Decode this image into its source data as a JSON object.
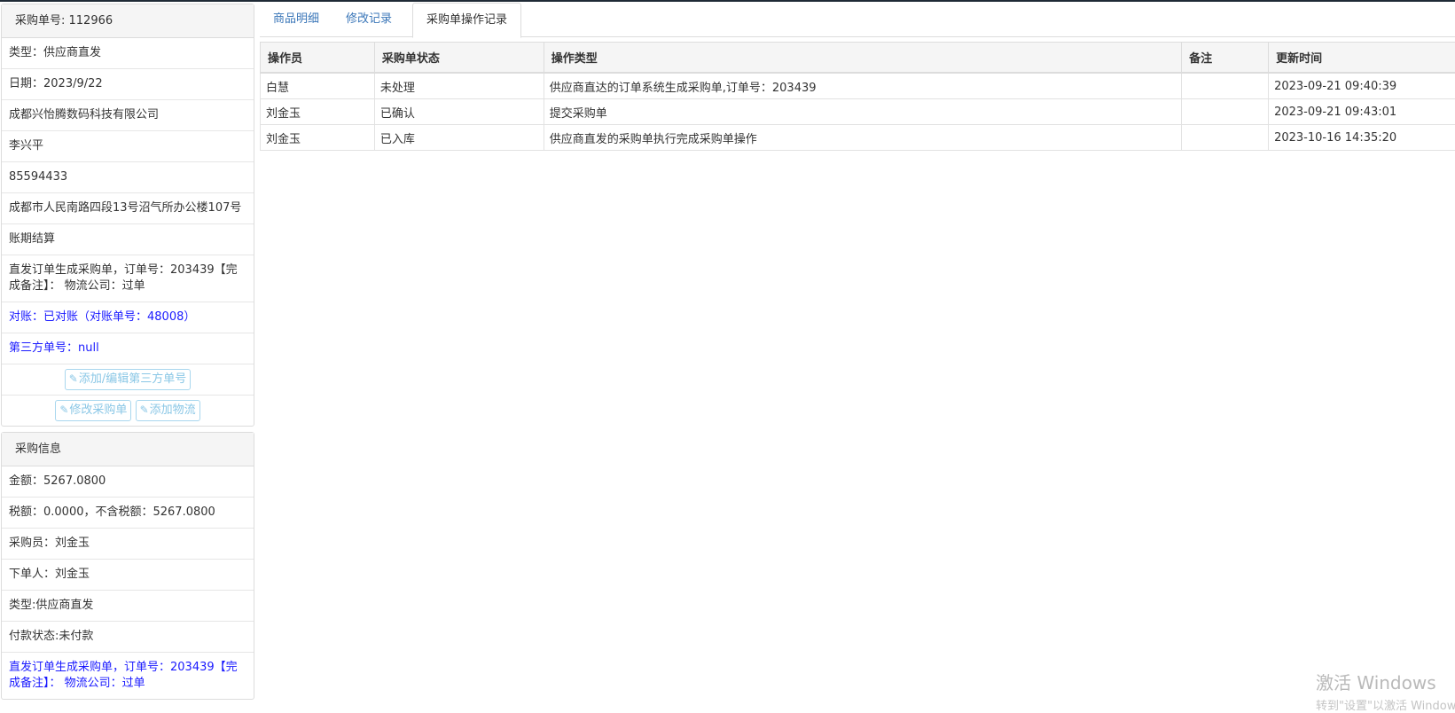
{
  "order_panel": {
    "heading": "采购单号: 112966",
    "rows": [
      "类型：供应商直发",
      "日期：2023/9/22",
      "成都兴怡腾数码科技有限公司",
      "李兴平",
      "85594433",
      "成都市人民南路四段13号沼气所办公楼107号",
      "账期结算"
    ],
    "note": "直发订单生成采购单，订单号：203439【完成备注】： 物流公司：过单",
    "reconcile": "对账：已对账（对账单号：48008）",
    "third_party": "第三方单号：null",
    "btn_third_party": "添加/编辑第三方单号",
    "btn_edit_order": "修改采购单",
    "btn_add_logistics": "添加物流"
  },
  "purchase_panel": {
    "heading": "采购信息",
    "rows": [
      "金额：5267.0800",
      "税额：0.0000，不含税额：5267.0800",
      "采购员：刘金玉",
      "下单人：刘金玉",
      "类型:供应商直发",
      "付款状态:未付款"
    ],
    "note": "直发订单生成采购单，订单号：203439【完成备注】： 物流公司：过单"
  },
  "tabs": [
    "商品明细",
    "修改记录",
    "采购单操作记录"
  ],
  "table": {
    "headers": [
      "操作员",
      "采购单状态",
      "操作类型",
      "备注",
      "更新时间"
    ],
    "rows": [
      [
        "白慧",
        "未处理",
        "供应商直达的订单系统生成采购单,订单号：203439",
        "",
        "2023-09-21 09:40:39"
      ],
      [
        "刘金玉",
        "已确认",
        "提交采购单",
        "",
        "2023-09-21 09:43:01"
      ],
      [
        "刘金玉",
        "已入库",
        "供应商直发的采购单执行完成采购单操作",
        "",
        "2023-10-16 14:35:20"
      ]
    ]
  },
  "watermark": {
    "line1": "激活 Windows",
    "line2": "转到\"设置\"以激活 Windows。"
  }
}
